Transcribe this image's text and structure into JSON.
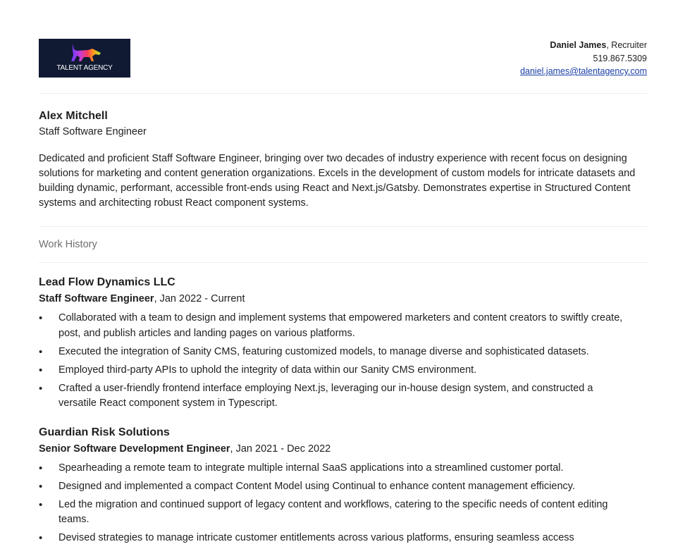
{
  "header": {
    "logo": {
      "text": "TALENT AGENCY",
      "icon": "dog-icon"
    },
    "recruiter": {
      "name": "Daniel James",
      "role_suffix": ", Recruiter",
      "phone": "519.867.5309",
      "email": "daniel.james@talentagency.com"
    }
  },
  "candidate": {
    "name": "Alex Mitchell",
    "title": "Staff Software Engineer",
    "summary": "Dedicated and proficient Staff Software Engineer, bringing over two decades of industry experience with recent focus on designing solutions for marketing and content generation organizations. Excels in the development of custom models for intricate datasets and building dynamic, performant, accessible front-ends using React and Next.js/Gatsby. Demonstrates expertise in Structured Content systems and architecting robust React component systems."
  },
  "work_history": {
    "section_title": "Work History",
    "jobs": [
      {
        "company": "Lead Flow Dynamics LLC",
        "role": "Staff Software Engineer",
        "dates": ", Jan 2022 - Current",
        "bullets": [
          "Collaborated with a team to design and implement systems that empowered marketers and content creators to swiftly create, post, and publish articles and landing pages on various platforms.",
          "Executed the integration of Sanity CMS, featuring customized models, to manage diverse and sophisticated datasets.",
          "Employed third-party APIs to uphold the integrity of data within our Sanity CMS environment.",
          "Crafted a user-friendly frontend interface employing Next.js, leveraging our in-house design system, and constructed a versatile React component system in Typescript."
        ]
      },
      {
        "company": "Guardian Risk Solutions",
        "role": "Senior Software Development Engineer",
        "dates": ", Jan 2021 - Dec 2022",
        "bullets": [
          "Spearheading a remote team to integrate multiple internal SaaS applications into a streamlined customer portal.",
          "Designed and implemented a compact Content Model using Continual to enhance content management efficiency.",
          "Led the migration and continued support of legacy content and workflows, catering to the specific needs of content editing teams.",
          "Devised strategies to manage intricate customer entitlements across various platforms, ensuring seamless access"
        ]
      }
    ]
  }
}
